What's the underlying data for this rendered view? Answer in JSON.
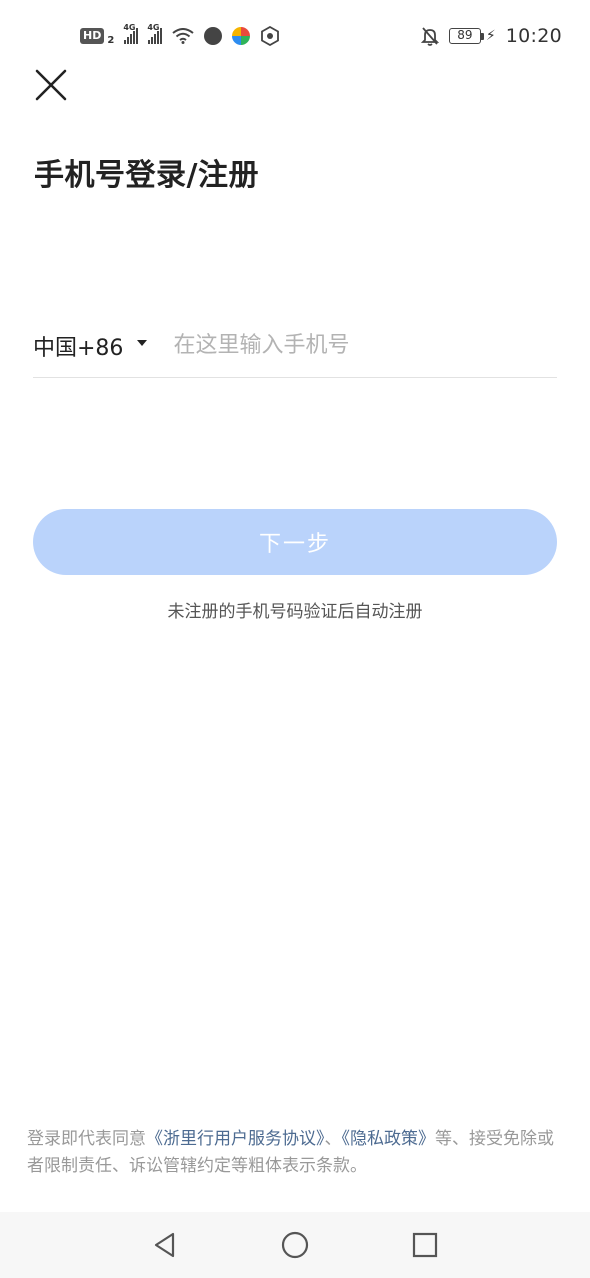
{
  "status_bar": {
    "hd_label": "HD",
    "sim_slot": "2",
    "network_1": "4G",
    "network_2": "4G",
    "battery_level": "89",
    "time": "10:20",
    "icons": [
      "hd-icon",
      "signal-icon",
      "signal-icon",
      "wifi-icon",
      "app-icon",
      "app-icon",
      "app-icon",
      "mute-icon",
      "battery-icon",
      "charging-icon"
    ]
  },
  "header": {
    "close_icon": "close-icon",
    "title": "手机号登录/注册"
  },
  "phone": {
    "country_code": "中国+86",
    "placeholder": "在这里输入手机号",
    "value": ""
  },
  "next_button": {
    "label": "下一步",
    "color": "#bad3fb"
  },
  "hint": "未注册的手机号码验证后自动注册",
  "agreement": {
    "prefix": "登录即代表同意",
    "link_terms": "《浙里行用户服务协议》",
    "separator": "、",
    "link_privacy": "《隐私政策》",
    "suffix": "等、接受免除或者限制责任、诉讼管辖约定等粗体表示条款。",
    "link_color": "#4d6b91"
  },
  "nav_bar": {
    "icons": [
      "back-icon",
      "home-icon",
      "recents-icon"
    ]
  }
}
